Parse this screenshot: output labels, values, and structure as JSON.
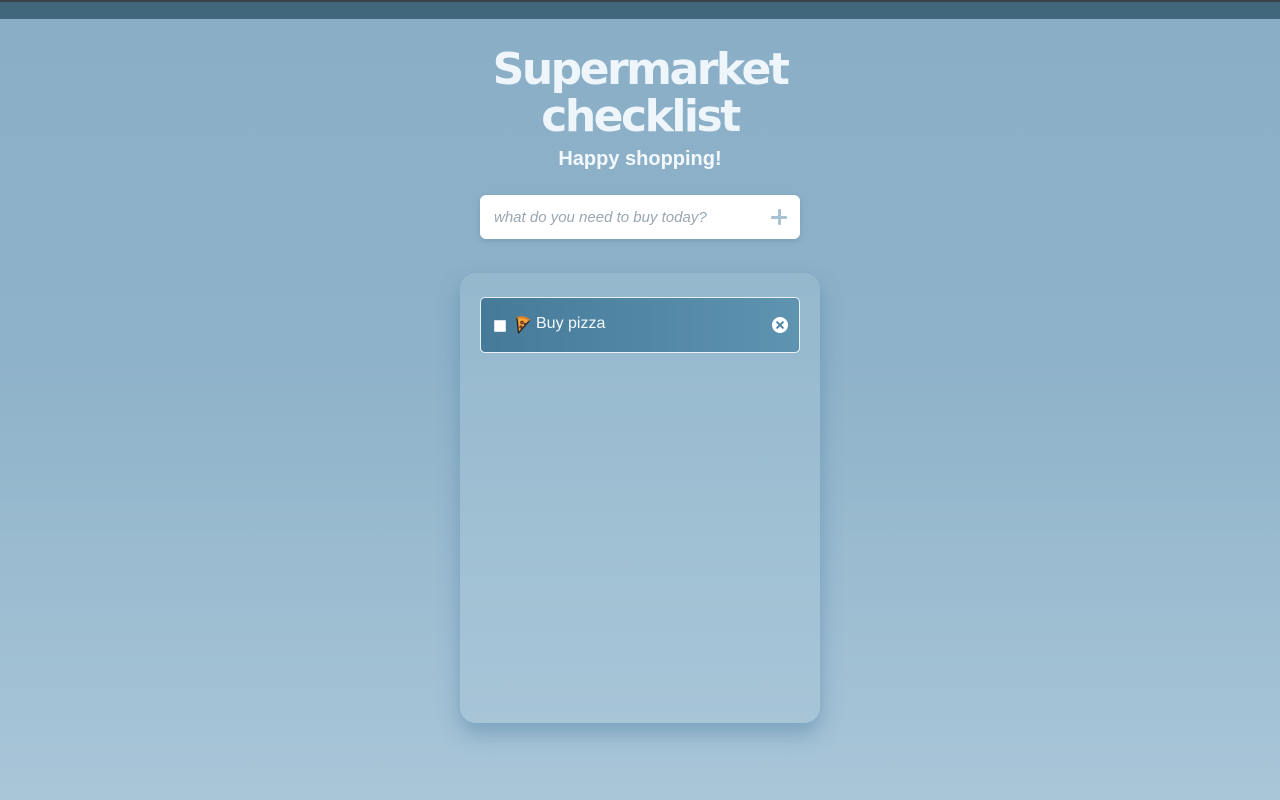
{
  "header": {
    "title": "Supermarket checklist",
    "subtitle": "Happy shopping!"
  },
  "add_form": {
    "placeholder": "what do you need to buy today?",
    "add_icon": "plus-icon"
  },
  "checklist": {
    "items": [
      {
        "label": "Buy pizza",
        "icon": "pizza-icon",
        "checked": false,
        "remove_icon": "close-circle-icon"
      }
    ]
  },
  "colors": {
    "background_top": "#8aaec6",
    "background_bottom": "#a9c6d8",
    "item_start": "#457a98",
    "item_end": "#5f94b1"
  }
}
